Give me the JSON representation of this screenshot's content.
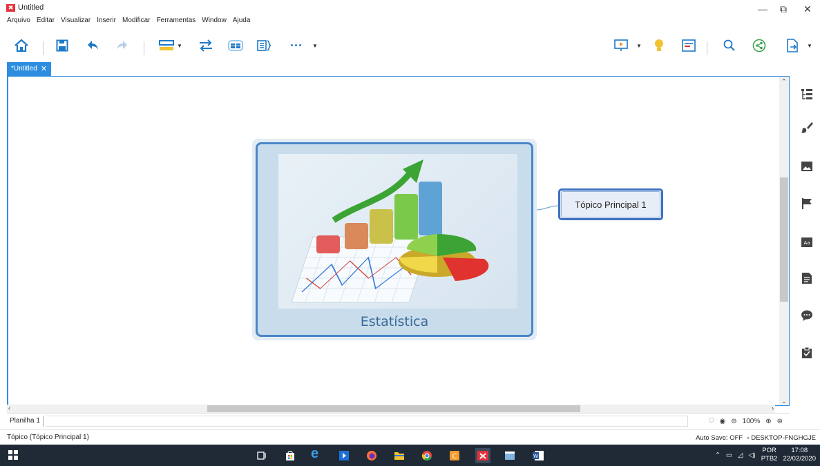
{
  "window": {
    "title": "Untitled",
    "minimize_glyph": "—",
    "restore_glyph": "⧉",
    "close_glyph": "✕"
  },
  "menu": [
    "Arquivo",
    "Editar",
    "Visualizar",
    "Inserir",
    "Modificar",
    "Ferramentas",
    "Window",
    "Ajuda"
  ],
  "toolbar_icons": [
    "home-icon",
    "save-icon",
    "undo-icon",
    "redo-icon",
    "topic-icon",
    "relationship-icon",
    "boundary-icon",
    "summary-icon",
    "more-icon",
    "presentation-icon",
    "idea-icon",
    "outline-icon",
    "search-icon",
    "share-icon",
    "export-icon"
  ],
  "tab": {
    "label": "*Untitled",
    "close": "✕"
  },
  "canvas": {
    "central_topic": {
      "title": "Estatística"
    },
    "subtopic": {
      "label": "Tópico Principal 1"
    }
  },
  "sheetbar": {
    "sheet_label": "Planilha 1",
    "zoom": "100%"
  },
  "statusbar": {
    "selection": "Tópico (Tópico Principal 1)",
    "autosave": "Auto Save: OFF",
    "computer": "DESKTOP-FNGHGJE"
  },
  "right_panel_icons": [
    "outline-panel-icon",
    "format-brush-icon",
    "image-icon",
    "flag-marker-icon",
    "text-style-icon",
    "notes-icon",
    "comment-icon",
    "task-icon"
  ],
  "taskbar": {
    "language": "POR",
    "layout": "PTB2",
    "time": "17:08",
    "date": "22/02/2020"
  },
  "colors": {
    "accent": "#2d8ee0",
    "topic_border": "#4a86c8",
    "taskbar": "#1f2a36",
    "central_text": "#3a6a99"
  }
}
